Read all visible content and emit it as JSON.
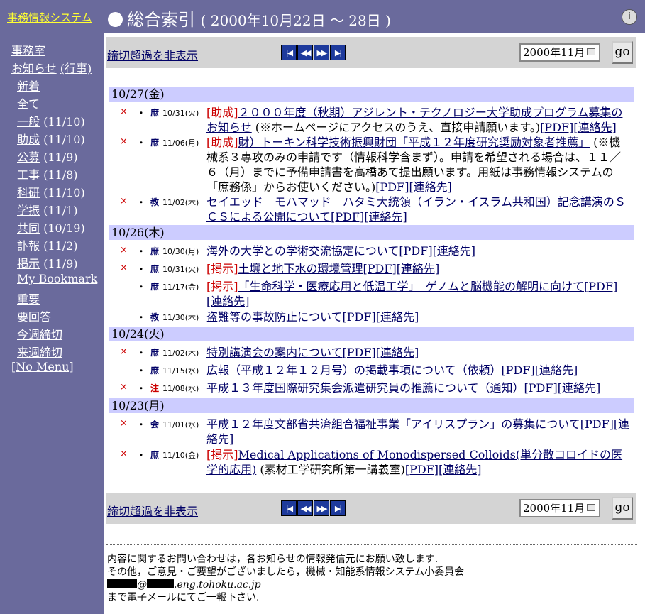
{
  "header": {
    "system_link": "事務情報システム",
    "title": "総合索引",
    "date_range": "( 2000年10月22日 〜 28日 )",
    "help_icon": "info-balloon-icon"
  },
  "sidebar": {
    "office": "事務室",
    "notices": "お知らせ",
    "events": "(行事)",
    "items": [
      {
        "label": "新着",
        "count": ""
      },
      {
        "label": "全て",
        "count": ""
      },
      {
        "label": "一般",
        "count": "(11/10)"
      },
      {
        "label": "助成",
        "count": "(11/10)"
      },
      {
        "label": "公募",
        "count": "(11/9)"
      },
      {
        "label": "工事",
        "count": "(11/8)"
      },
      {
        "label": "科研",
        "count": "(11/10)"
      },
      {
        "label": "学振",
        "count": "(11/1)"
      },
      {
        "label": "共同",
        "count": "(10/19)"
      },
      {
        "label": "訃報",
        "count": "(11/2)"
      },
      {
        "label": "掲示",
        "count": "(11/9)"
      },
      {
        "label": "My Bookmark",
        "count": ""
      },
      {
        "label": "重要",
        "count": ""
      },
      {
        "label": "要回答",
        "count": ""
      },
      {
        "label": "今週締切",
        "count": ""
      },
      {
        "label": "来週締切",
        "count": ""
      }
    ],
    "no_menu": "[No Menu]"
  },
  "toolbar": {
    "hide_overdue": "締切超過を非表示",
    "nav_first": "|◀",
    "nav_prev": "◀◀",
    "nav_next": "▶▶",
    "nav_last": "▶|",
    "month_value": "2000年11月",
    "go_label": "go"
  },
  "groups": [
    {
      "date": "10/27(金)",
      "entries": [
        {
          "x": "×",
          "tag": "庶",
          "due": "10/31(火)",
          "cat": "[助成]",
          "title": "２０００年度（秋期）アジレント・テクノロジー大学助成プログラム募集のお知らせ",
          "note": " (※ホームページにアクセスのうえ、直接申請願います。)",
          "pdf": "[PDF]",
          "contact": "[連絡先]"
        },
        {
          "x": "×",
          "tag": "庶",
          "due": "11/06(月)",
          "cat": "[助成]",
          "title": "財）トーキン科学技術振興財団「平成１２年度研究奨励対象者推薦」",
          "note": " (※機械系３専攻のみの申請です（情報科学含まず）。申請を希望される場合は、１１／６（月）までに予備申請書を高橋あて提出願います。用紙は事務情報システムの「庶務係」からお使いください。)",
          "pdf": "[PDF]",
          "contact": "[連絡先]"
        },
        {
          "x": "×",
          "tag": "教",
          "due": "11/02(木)",
          "cat": "",
          "title": "セイエッド　モハマッド　ハタミ大統領（イラン・イスラム共和国）記念講演のＳＣＳによる公開について",
          "note": "",
          "pdf": "[PDF]",
          "contact": "[連絡先]"
        }
      ]
    },
    {
      "date": "10/26(木)",
      "entries": [
        {
          "x": "×",
          "tag": "庶",
          "due": "10/30(月)",
          "cat": "",
          "title": "海外の大学との学術交流協定について",
          "note": "",
          "pdf": "[PDF]",
          "contact": "[連絡先]"
        },
        {
          "x": "×",
          "tag": "庶",
          "due": "10/31(火)",
          "cat": "[掲示]",
          "title": "土壌と地下水の環境管理",
          "note": "",
          "pdf": "[PDF]",
          "contact": "[連絡先]"
        },
        {
          "x": "",
          "tag": "庶",
          "due": "11/17(金)",
          "cat": "[掲示]",
          "title": "「生命科学・医療応用と低温工学」　ゲノムと脳機能の解明に向けて",
          "note": "",
          "pdf": "[PDF]",
          "contact": "[連絡先]"
        },
        {
          "x": "",
          "tag": "教",
          "due": "11/30(木)",
          "cat": "",
          "title": "盗難等の事故防止について",
          "note": "",
          "pdf": "[PDF]",
          "contact": "[連絡先]"
        }
      ]
    },
    {
      "date": "10/24(火)",
      "entries": [
        {
          "x": "×",
          "tag": "庶",
          "due": "11/02(木)",
          "cat": "",
          "title": "特別講演会の案内について",
          "note": "",
          "pdf": "[PDF]",
          "contact": "[連絡先]"
        },
        {
          "x": "",
          "tag": "庶",
          "due": "11/15(水)",
          "cat": "",
          "title": "広報（平成１２年１２月号）の掲載事項について（依頼）",
          "note": "",
          "pdf": "[PDF]",
          "contact": "[連絡先]"
        },
        {
          "x": "×",
          "tag": "注",
          "due": "11/08(水)",
          "cat": "",
          "title": "平成１３年度国際研究集会派遣研究員の推薦について（通知）",
          "note": "",
          "pdf": "[PDF]",
          "contact": "[連絡先]"
        }
      ]
    },
    {
      "date": "10/23(月)",
      "entries": [
        {
          "x": "×",
          "tag": "会",
          "due": "11/01(水)",
          "cat": "",
          "title": "平成１２年度文部省共済組合福祉事業「アイリスプラン」の募集について",
          "note": "",
          "pdf": "[PDF]",
          "contact": "[連絡先]"
        },
        {
          "x": "×",
          "tag": "庶",
          "due": "11/10(金)",
          "cat": "[掲示]",
          "title": "Medical Applications of Monodispersed Colloids(単分散コロイドの医学的応用)",
          "note": " (素材工学研究所第一講義室)",
          "pdf": "[PDF]",
          "contact": "[連絡先]"
        }
      ]
    }
  ],
  "footer": {
    "line1": "内容に関するお問い合わせは，各お知らせの情報発信元にお願い致します.",
    "line2": "その他，ご意見・ご要望がございましたら，機械・知能系情報システム小委員会",
    "email_at": "@",
    "email_domain": ".eng.tohoku.ac.jp",
    "line4": "まで電子メールにてご一報下さい."
  }
}
